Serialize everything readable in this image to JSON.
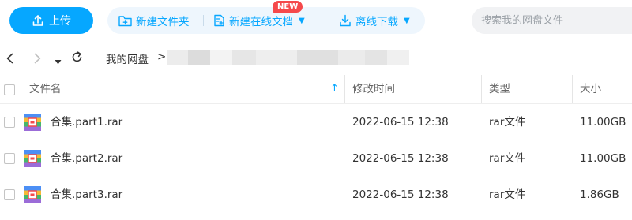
{
  "toolbar": {
    "upload_label": "上传",
    "new_folder_label": "新建文件夹",
    "new_online_doc_label": "新建在线文档",
    "new_badge": "NEW",
    "offline_download_label": "离线下载"
  },
  "search": {
    "placeholder": "搜索我的网盘文件"
  },
  "breadcrumb": {
    "root": "我的网盘",
    "separator": ">"
  },
  "table": {
    "headers": {
      "name": "文件名",
      "modified": "修改时间",
      "type": "类型",
      "size": "大小"
    },
    "sort_indicator": "↑",
    "rows": [
      {
        "name": "合集.part1.rar",
        "modified": "2022-06-15 12:38",
        "type": "rar文件",
        "size": "11.00GB"
      },
      {
        "name": "合集.part2.rar",
        "modified": "2022-06-15 12:38",
        "type": "rar文件",
        "size": "11.00GB"
      },
      {
        "name": "合集.part3.rar",
        "modified": "2022-06-15 12:38",
        "type": "rar文件",
        "size": "1.86GB"
      }
    ]
  },
  "colors": {
    "accent": "#06a7ff",
    "badge": "#f5494b",
    "pill_bg": "#eef6fd"
  },
  "icons": [
    "upload-icon",
    "new-folder-icon",
    "new-doc-icon",
    "download-icon",
    "back-icon",
    "forward-icon",
    "dropdown-icon",
    "refresh-icon",
    "rar-file-icon"
  ]
}
